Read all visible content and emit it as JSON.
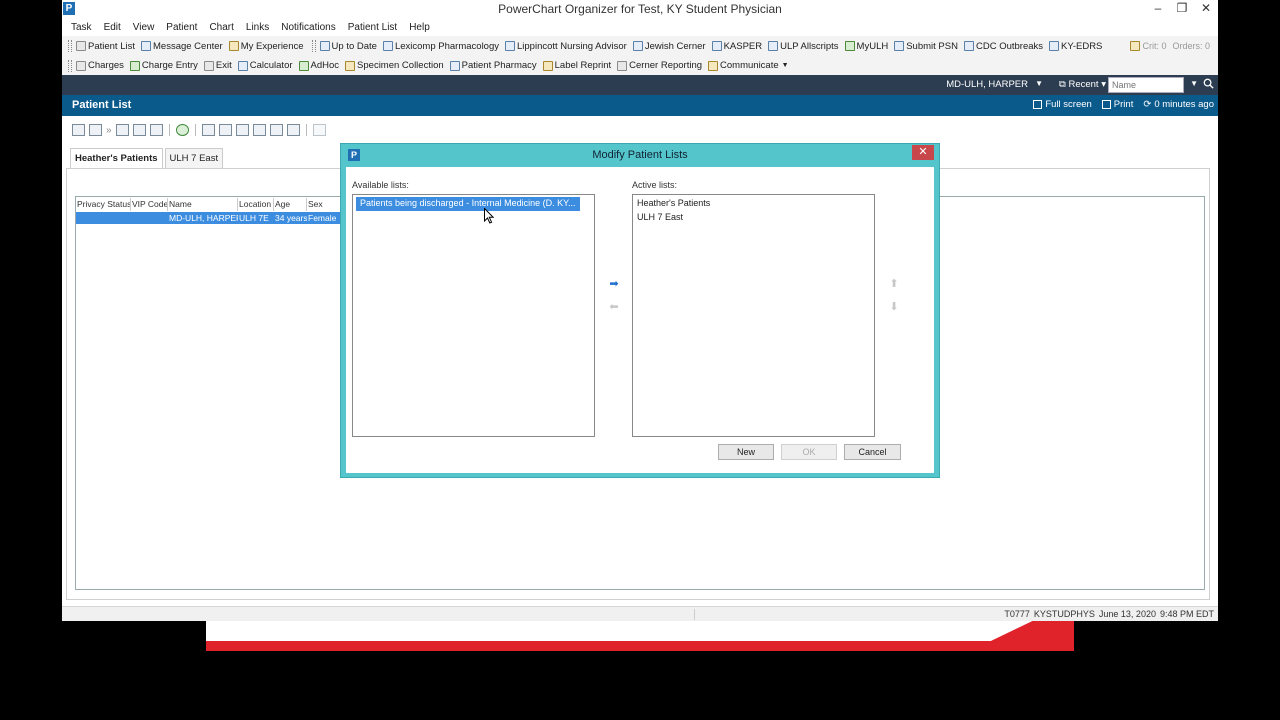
{
  "window": {
    "title": "PowerChart Organizer for Test, KY Student Physician",
    "logo": "P"
  },
  "menu": [
    "Task",
    "Edit",
    "View",
    "Patient",
    "Chart",
    "Links",
    "Notifications",
    "Patient List",
    "Help"
  ],
  "toolbar1": {
    "items": [
      "Patient List",
      "Message Center",
      "My Experience",
      "Up to Date",
      "Lexicomp Pharmacology",
      "Lippincott Nursing Advisor",
      "Jewish Cerner",
      "KASPER",
      "ULP Allscripts",
      "MyULH",
      "Submit PSN",
      "CDC Outbreaks",
      "KY-EDRS"
    ],
    "crit": "Crit: 0",
    "orders": "Orders: 0"
  },
  "toolbar2": {
    "items": [
      "Charges",
      "Charge Entry",
      "Exit",
      "Calculator",
      "AdHoc",
      "Specimen Collection",
      "Patient Pharmacy",
      "Label Reprint",
      "Cerner Reporting",
      "Communicate"
    ]
  },
  "userbar": {
    "user": "MD-ULH, HARPER",
    "recent": "Recent",
    "name_placeholder": "Name"
  },
  "patient_list": {
    "title": "Patient List",
    "full_screen": "Full screen",
    "print": "Print",
    "refreshed": "0 minutes ago",
    "tabs": [
      "Heather's Patients",
      "ULH 7 East"
    ],
    "columns": [
      "Privacy Status",
      "VIP Code",
      "Name",
      "Location",
      "Age",
      "Sex"
    ],
    "rows": [
      {
        "privacy": "",
        "vip": "",
        "name": "MD-ULH, HARPER",
        "location": "ULH 7E",
        "age": "34 years",
        "sex": "Female"
      }
    ]
  },
  "modal": {
    "title": "Modify Patient Lists",
    "available_label": "Available lists:",
    "active_label": "Active lists:",
    "available": [
      "Patients being discharged - Internal Medicine  (D. KY..."
    ],
    "active": [
      "Heather's Patients",
      "ULH 7 East"
    ],
    "btn_new": "New",
    "btn_ok": "OK",
    "btn_cancel": "Cancel"
  },
  "status": {
    "terminal": "T0777",
    "user": "KYSTUDPHYS",
    "date": "June 13, 2020",
    "time": "9:48 PM EDT"
  },
  "colors": {
    "header_blue": "#0b5a8c",
    "userbar": "#2c3d52",
    "modal_frame": "#55c5cc",
    "selection": "#3c8de0",
    "brand_red": "#e0232b"
  }
}
